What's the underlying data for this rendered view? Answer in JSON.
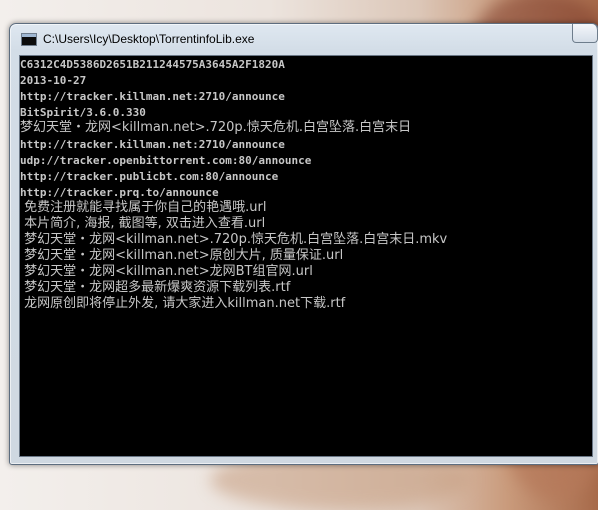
{
  "window": {
    "title": "C:\\Users\\Icy\\Desktop\\TorrentinfoLib.exe"
  },
  "console": {
    "lines": [
      "C6312C4D5386D2651B211244575A3645A2F1820A",
      "2013-10-27",
      "http://tracker.killman.net:2710/announce",
      "BitSpirit/3.6.0.330",
      "梦幻天堂・龙网<killman.net>.720p.惊天危机.白宫坠落.白宫末日",
      "http://tracker.killman.net:2710/announce",
      "udp://tracker.openbittorrent.com:80/announce",
      "http://tracker.publicbt.com:80/announce",
      "http://tracker.prq.to/announce",
      " 免费注册就能寻找属于你自己的艳遇哦.url",
      " 本片简介, 海报, 截图等, 双击进入查看.url",
      " 梦幻天堂・龙网<killman.net>.720p.惊天危机.白宫坠落.白宫末日.mkv",
      " 梦幻天堂・龙网<killman.net>原创大片, 质量保证.url",
      " 梦幻天堂・龙网<killman.net>龙网BT组官网.url",
      " 梦幻天堂・龙网超多最新爆爽资源下载列表.rtf",
      " 龙网原创即将停止外发, 请大家进入killman.net下载.rtf"
    ]
  }
}
